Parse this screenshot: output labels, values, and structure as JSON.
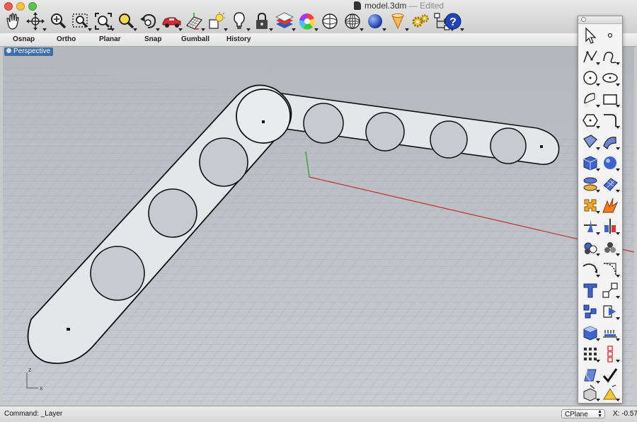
{
  "window": {
    "doc_name": "model.3dm",
    "separator": "—",
    "doc_state": "Edited"
  },
  "toolbar": {
    "tools": [
      "pan-hand",
      "rotate-view",
      "zoom",
      "zoom-window",
      "zoom-extents",
      "zoom-selected",
      "undo-view",
      "car-render",
      "grid-plane",
      "light-object",
      "lightbulb",
      "lock",
      "layer",
      "color-wheel",
      "sphere-display",
      "mesh-sphere",
      "shaded-sphere",
      "cone-light",
      "gear-settings",
      "hierarchy",
      "help"
    ]
  },
  "modes": [
    "Osnap",
    "Ortho",
    "Planar",
    "Snap",
    "Gumball",
    "History"
  ],
  "viewport": {
    "label": "Perspective",
    "axis_z": "z",
    "axis_x": "x"
  },
  "statusbar": {
    "command": "Command: _Layer",
    "cplane": "CPlane",
    "coord": "X: -0.57"
  },
  "palette": {
    "tools": [
      "select-arrow",
      "point",
      "polyline",
      "curve",
      "circle",
      "ellipse",
      "arc",
      "rectangle",
      "polygon",
      "fillet-curve",
      "surface",
      "sweep",
      "box",
      "sphere",
      "extrude",
      "mesh",
      "boolean",
      "explode",
      "trim",
      "split",
      "group",
      "join",
      "offset",
      "curve-fillet",
      "text",
      "transform",
      "array",
      "orient",
      "shade",
      "dimension",
      "grid-array",
      "vertical-array",
      "rebuild",
      "check",
      "render",
      "light"
    ]
  }
}
